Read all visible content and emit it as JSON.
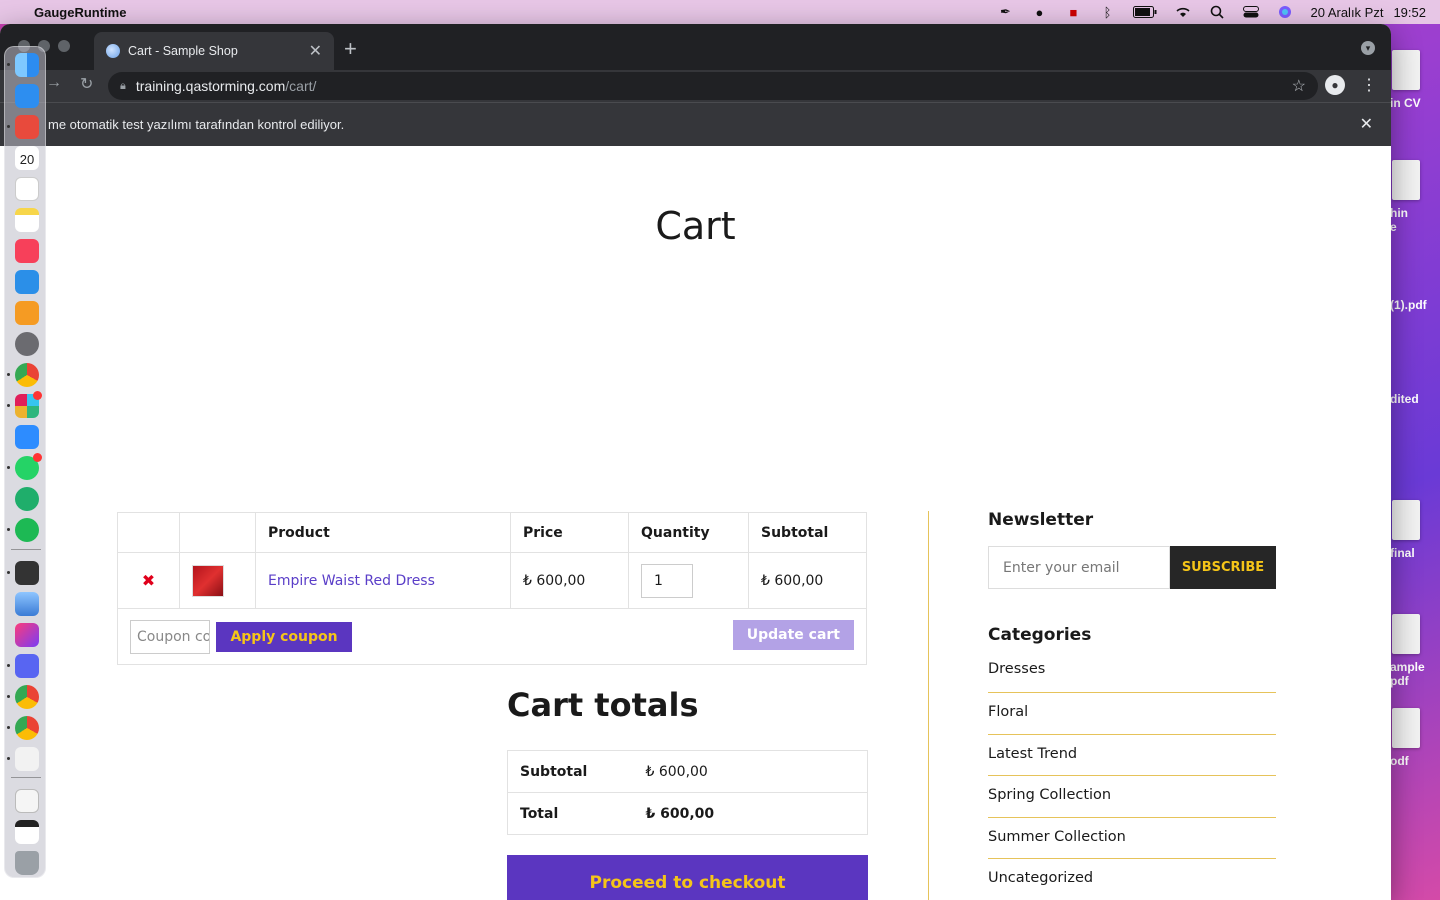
{
  "menubar": {
    "app_name": "GaugeRuntime",
    "date": "20 Aralık Pzt",
    "time": "19:52"
  },
  "desktop_files": [
    "in CV",
    "hin",
    "e",
    "(1).pdf",
    "dited",
    "final",
    "ample",
    "pdf",
    "odf"
  ],
  "browser": {
    "tab_title": "Cart - Sample Shop",
    "url_domain": "training.qastorming.com",
    "url_path": "/cart/",
    "infobar_text": "me otomatik test yazılımı tarafından kontrol ediliyor."
  },
  "page": {
    "title": "Cart",
    "cart_table": {
      "headers": [
        "",
        "",
        "Product",
        "Price",
        "Quantity",
        "Subtotal"
      ],
      "items": [
        {
          "remove": "✖",
          "name": "Empire Waist Red Dress",
          "price": "₺ 600,00",
          "quantity": "1",
          "subtotal": "₺ 600,00"
        }
      ],
      "coupon_placeholder": "Coupon code",
      "apply_coupon": "Apply coupon",
      "update_cart": "Update cart"
    },
    "cart_totals": {
      "title": "Cart totals",
      "subtotal_label": "Subtotal",
      "subtotal_value": "₺ 600,00",
      "total_label": "Total",
      "total_value": "₺ 600,00",
      "checkout": "Proceed to checkout"
    },
    "sidebar": {
      "newsletter_title": "Newsletter",
      "email_placeholder": "Enter your email",
      "subscribe": "SUBSCRIBE",
      "categories_title": "Categories",
      "categories": [
        "Dresses",
        "Floral",
        "Latest Trend",
        "Spring Collection",
        "Summer Collection",
        "Uncategorized"
      ]
    }
  },
  "dock": {
    "calendar_day": "20",
    "apps": [
      "finder-icon",
      "mail-icon",
      "gmail-icon",
      "calendar-icon",
      "reminders-icon",
      "notes-icon",
      "music-icon",
      "keynote-icon",
      "pages-icon",
      "settings-icon",
      "chrome-icon",
      "slack-icon",
      "zoom-icon",
      "whatsapp-icon",
      "cloud-icon",
      "spotify-icon",
      "gauge-icon",
      "preview-icon",
      "intellij-icon",
      "discord-icon",
      "chrome-icon",
      "chrome-icon",
      "java-icon",
      "file-icon",
      "window-icon",
      "trash-icon"
    ]
  },
  "colors": {
    "accent": "#5b36c0",
    "accent_text": "#f5c518",
    "divider": "#e6c35a",
    "remove": "#e0001b"
  }
}
